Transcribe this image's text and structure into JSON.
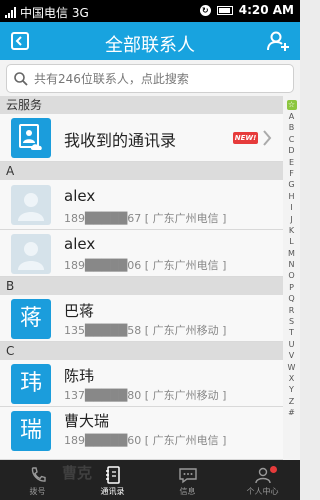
{
  "status": {
    "carrier": "中国电信 3G",
    "time": "4:20 AM"
  },
  "header": {
    "title": "全部联系人"
  },
  "search": {
    "placeholder": "共有246位联系人，点此搜索"
  },
  "cloud": {
    "section": "云服务",
    "label": "我收到的通讯录",
    "badge": "NEW!"
  },
  "sections": [
    {
      "letter": "A",
      "contacts": [
        {
          "name": "alex",
          "detail": "189█████67 [ 广东广州电信 ]",
          "avatar": ""
        },
        {
          "name": "alex",
          "detail": "189█████06 [ 广东广州电信 ]",
          "avatar": ""
        }
      ]
    },
    {
      "letter": "B",
      "contacts": [
        {
          "name": "巴蒋",
          "detail": "135█████58 [ 广东广州移动 ]",
          "avatar": "蒋"
        }
      ]
    },
    {
      "letter": "C",
      "contacts": [
        {
          "name": "陈玮",
          "detail": "137█████80 [ 广东广州移动 ]",
          "avatar": "玮"
        },
        {
          "name": "曹大瑞",
          "detail": "189█████60 [ 广东广州电信 ]",
          "avatar": "瑞"
        }
      ]
    }
  ],
  "index_letters": [
    "A",
    "B",
    "C",
    "D",
    "E",
    "F",
    "G",
    "H",
    "I",
    "J",
    "K",
    "L",
    "M",
    "N",
    "O",
    "P",
    "Q",
    "R",
    "S",
    "T",
    "U",
    "V",
    "W",
    "X",
    "Y",
    "Z",
    "#"
  ],
  "tabs": [
    {
      "label": "拨号",
      "icon": "phone-icon"
    },
    {
      "label": "通讯录",
      "icon": "contacts-icon"
    },
    {
      "label": "信息",
      "icon": "message-icon"
    },
    {
      "label": "个人中心",
      "icon": "person-icon"
    }
  ],
  "ghost_text": "曹克",
  "colors": {
    "primary": "#18a3df",
    "avatar": "#1b9ddc",
    "badge": "#e63b3b",
    "index_star": "#8cc63f"
  }
}
